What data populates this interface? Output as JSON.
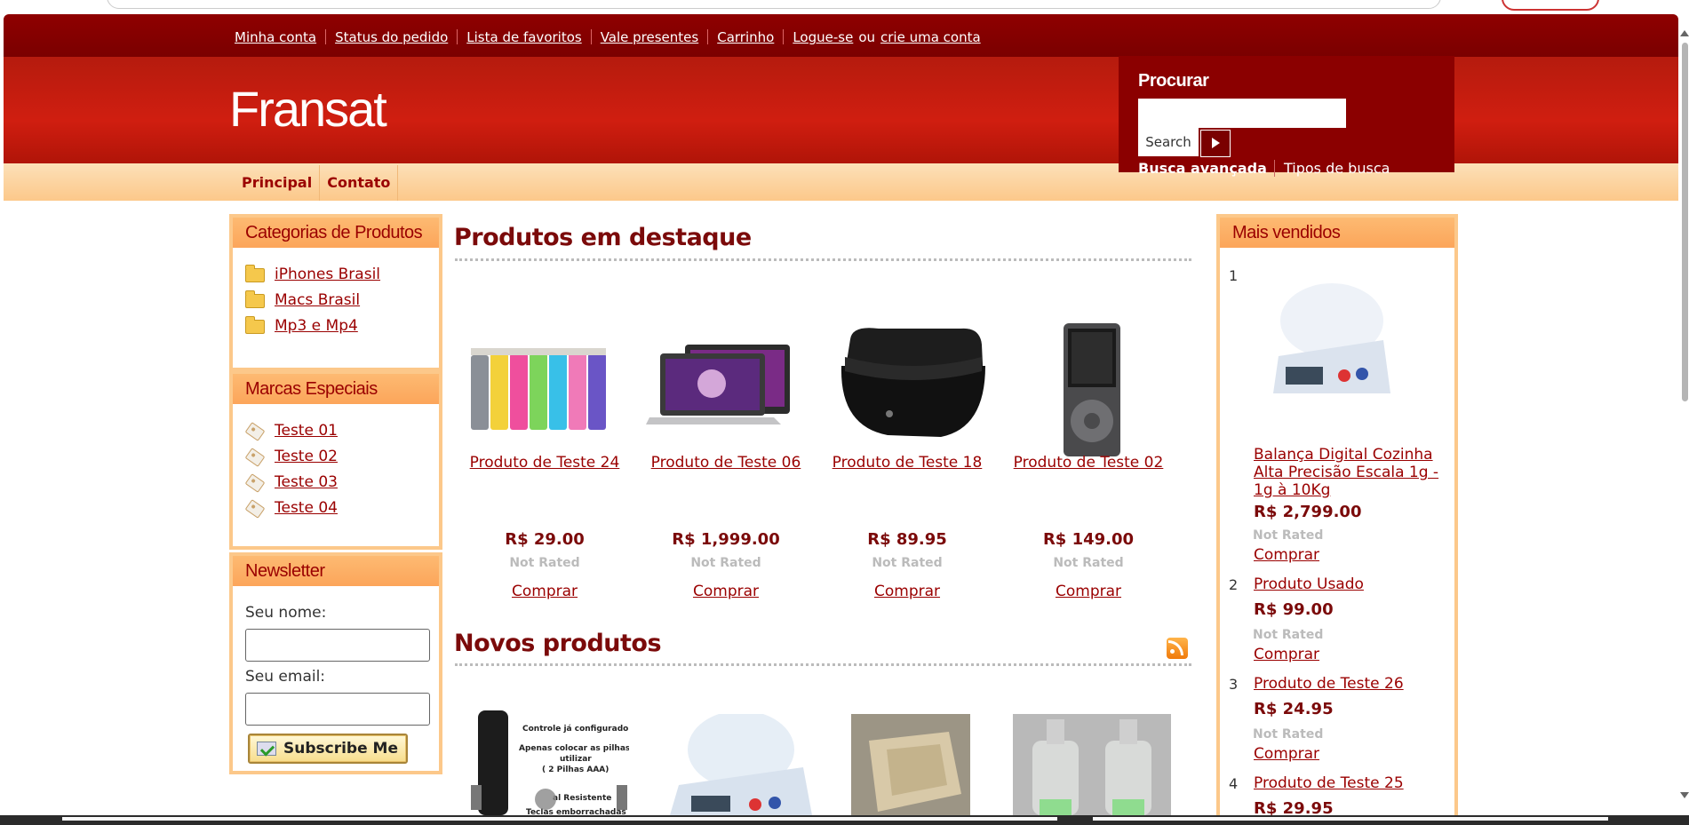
{
  "toplinks": {
    "account": "Minha conta",
    "order_status": "Status do pedido",
    "wishlist": "Lista de favoritos",
    "gift": "Vale presentes",
    "cart": "Carrinho",
    "login": "Logue-se",
    "or": "ou",
    "create": "crie uma conta"
  },
  "site": {
    "name": "Fransat"
  },
  "search": {
    "title": "Procurar",
    "button": "Search",
    "advanced": "Busca avançada",
    "types": "Tipos de busca"
  },
  "nav": {
    "home": "Principal",
    "contact": "Contato"
  },
  "categories": {
    "title": "Categorias de Produtos",
    "items": [
      "iPhones Brasil",
      "Macs Brasil",
      "Mp3 e Mp4"
    ]
  },
  "brands": {
    "title": "Marcas Especiais",
    "items": [
      "Teste 01",
      "Teste 02",
      "Teste 03",
      "Teste 04"
    ]
  },
  "newsletter": {
    "title": "Newsletter",
    "name_label": "Seu nome:",
    "email_label": "Seu email:",
    "button": "Subscribe Me"
  },
  "featured": {
    "title": "Produtos em destaque",
    "products": [
      {
        "name": "Produto de Teste 24",
        "price": "R$ 29.00",
        "rating": "Not Rated",
        "buy": "Comprar"
      },
      {
        "name": "Produto de Teste 06",
        "price": "R$ 1,999.00",
        "rating": "Not Rated",
        "buy": "Comprar"
      },
      {
        "name": "Produto de Teste 18",
        "price": "R$ 89.95",
        "rating": "Not Rated",
        "buy": "Comprar"
      },
      {
        "name": "Produto de Teste 02",
        "price": "R$ 149.00",
        "rating": "Not Rated",
        "buy": "Comprar"
      }
    ]
  },
  "new_products": {
    "title": "Novos produtos",
    "remote_caption": [
      "Controle já configurado",
      "Apenas colocar as pilhas e",
      "utilizar",
      "( 2 Pilhas AAA)",
      "al Resistente",
      "Teclas emborrachadas de"
    ]
  },
  "bestsellers": {
    "title": "Mais vendidos",
    "items": [
      {
        "rank": "1",
        "name": "Balança Digital Cozinha Alta Precisão Escala 1g - 1g à 10Kg",
        "price": "R$ 2,799.00",
        "rating": "Not Rated",
        "buy": "Comprar"
      },
      {
        "rank": "2",
        "name": "Produto Usado",
        "price": "R$ 99.00",
        "rating": "Not Rated",
        "buy": "Comprar"
      },
      {
        "rank": "3",
        "name": "Produto de Teste 26",
        "price": "R$ 24.95",
        "rating": "Not Rated",
        "buy": "Comprar"
      },
      {
        "rank": "4",
        "name": "Produto de Teste 25",
        "price": "R$ 29.95"
      }
    ]
  },
  "colors": {
    "header_dark": "#8b0000",
    "header_red": "#c41a0c",
    "accent_orange": "#fcc88a",
    "link": "#9a0000"
  }
}
